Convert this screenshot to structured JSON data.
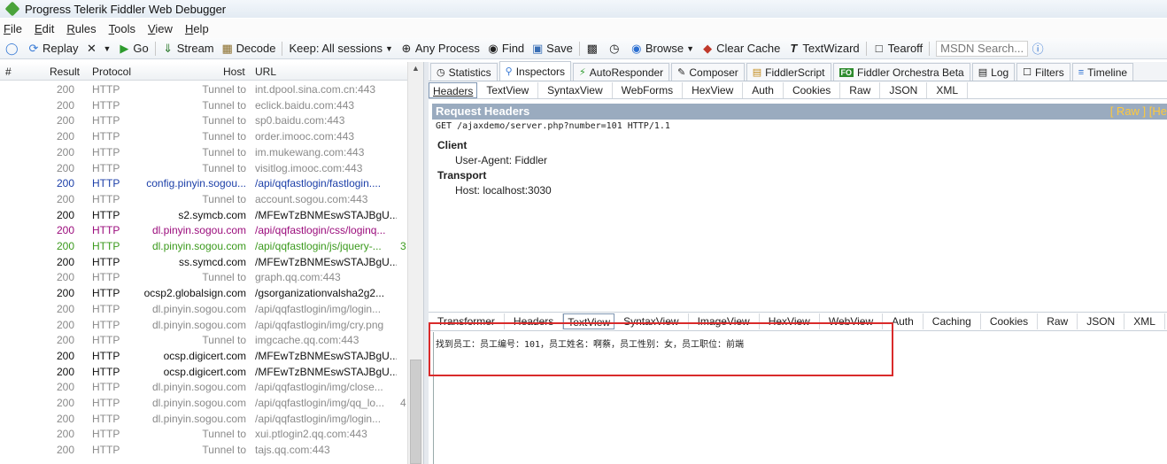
{
  "window": {
    "title": "Progress Telerik Fiddler Web Debugger"
  },
  "menu": [
    "File",
    "Edit",
    "Rules",
    "Tools",
    "View",
    "Help"
  ],
  "toolbar": {
    "replay": "Replay",
    "go": "Go",
    "stream": "Stream",
    "decode": "Decode",
    "keep": "Keep: All sessions",
    "any_process": "Any Process",
    "find": "Find",
    "save": "Save",
    "browse": "Browse",
    "clear_cache": "Clear Cache",
    "textwizard": "TextWizard",
    "tearoff": "Tearoff",
    "msdn_placeholder": "MSDN Search..."
  },
  "session_list": {
    "columns": [
      "#",
      "Result",
      "Protocol",
      "Host",
      "URL"
    ],
    "rows": [
      {
        "id": "42",
        "result": "200",
        "protocol": "HTTP",
        "host": "Tunnel to",
        "url": "int.dpool.sina.com.cn:443",
        "style": "tunnel"
      },
      {
        "id": "43",
        "result": "200",
        "protocol": "HTTP",
        "host": "Tunnel to",
        "url": "eclick.baidu.com:443",
        "style": "tunnel"
      },
      {
        "id": "44",
        "result": "200",
        "protocol": "HTTP",
        "host": "Tunnel to",
        "url": "sp0.baidu.com:443",
        "style": "tunnel"
      },
      {
        "id": "45",
        "result": "200",
        "protocol": "HTTP",
        "host": "Tunnel to",
        "url": "order.imooc.com:443",
        "style": "tunnel"
      },
      {
        "id": "46",
        "result": "200",
        "protocol": "HTTP",
        "host": "Tunnel to",
        "url": "im.mukewang.com:443",
        "style": "tunnel"
      },
      {
        "id": "47",
        "result": "200",
        "protocol": "HTTP",
        "host": "Tunnel to",
        "url": "visitlog.imooc.com:443",
        "style": "tunnel"
      },
      {
        "id": "48",
        "result": "200",
        "protocol": "HTTP",
        "host": "config.pinyin.sogou...",
        "url": "/api/qqfastlogin/fastlogin....",
        "style": "blue"
      },
      {
        "id": "49",
        "result": "200",
        "protocol": "HTTP",
        "host": "Tunnel to",
        "url": "account.sogou.com:443",
        "style": "tunnel"
      },
      {
        "id": "50",
        "result": "200",
        "protocol": "HTTP",
        "host": "s2.symcb.com",
        "url": "/MFEwTzBNMEswSTAJBgU...",
        "style": "dark"
      },
      {
        "id": "51",
        "result": "200",
        "protocol": "HTTP",
        "host": "dl.pinyin.sogou.com",
        "url": "/api/qqfastlogin/css/loginq...",
        "style": "purple"
      },
      {
        "id": "52",
        "result": "200",
        "protocol": "HTTP",
        "host": "dl.pinyin.sogou.com",
        "url": "/api/qqfastlogin/js/jquery-...",
        "style": "green",
        "extra": "3"
      },
      {
        "id": "53",
        "result": "200",
        "protocol": "HTTP",
        "host": "ss.symcd.com",
        "url": "/MFEwTzBNMEswSTAJBgU...",
        "style": "dark"
      },
      {
        "id": "54",
        "result": "200",
        "protocol": "HTTP",
        "host": "Tunnel to",
        "url": "graph.qq.com:443",
        "style": "tunnel"
      },
      {
        "id": "55",
        "result": "200",
        "protocol": "HTTP",
        "host": "ocsp2.globalsign.com",
        "url": "/gsorganizationvalsha2g2...",
        "style": "dark"
      },
      {
        "id": "56",
        "result": "200",
        "protocol": "HTTP",
        "host": "dl.pinyin.sogou.com",
        "url": "/api/qqfastlogin/img/login...",
        "style": "tunnel"
      },
      {
        "id": "57",
        "result": "200",
        "protocol": "HTTP",
        "host": "dl.pinyin.sogou.com",
        "url": "/api/qqfastlogin/img/cry.png",
        "style": "tunnel"
      },
      {
        "id": "58",
        "result": "200",
        "protocol": "HTTP",
        "host": "Tunnel to",
        "url": "imgcache.qq.com:443",
        "style": "tunnel"
      },
      {
        "id": "59",
        "result": "200",
        "protocol": "HTTP",
        "host": "ocsp.digicert.com",
        "url": "/MFEwTzBNMEswSTAJBgU...",
        "style": "dark"
      },
      {
        "id": "60",
        "result": "200",
        "protocol": "HTTP",
        "host": "ocsp.digicert.com",
        "url": "/MFEwTzBNMEswSTAJBgU...",
        "style": "dark"
      },
      {
        "id": "61",
        "result": "200",
        "protocol": "HTTP",
        "host": "dl.pinyin.sogou.com",
        "url": "/api/qqfastlogin/img/close...",
        "style": "tunnel"
      },
      {
        "id": "62",
        "result": "200",
        "protocol": "HTTP",
        "host": "dl.pinyin.sogou.com",
        "url": "/api/qqfastlogin/img/qq_lo...",
        "style": "tunnel",
        "extra": "4"
      },
      {
        "id": "63",
        "result": "200",
        "protocol": "HTTP",
        "host": "dl.pinyin.sogou.com",
        "url": "/api/qqfastlogin/img/login...",
        "style": "tunnel"
      },
      {
        "id": "64",
        "result": "200",
        "protocol": "HTTP",
        "host": "Tunnel to",
        "url": "xui.ptlogin2.qq.com:443",
        "style": "tunnel"
      },
      {
        "id": "65",
        "result": "200",
        "protocol": "HTTP",
        "host": "Tunnel to",
        "url": "tajs.qq.com:443",
        "style": "tunnel"
      }
    ]
  },
  "inspector": {
    "main_tabs": [
      "Statistics",
      "Inspectors",
      "AutoResponder",
      "Composer",
      "FiddlerScript",
      "Fiddler Orchestra Beta",
      "Log",
      "Filters",
      "Timeline"
    ],
    "fo_badge": "FO",
    "request_tabs": [
      "Headers",
      "TextView",
      "SyntaxView",
      "WebForms",
      "HexView",
      "Auth",
      "Cookies",
      "Raw",
      "JSON",
      "XML"
    ],
    "request_header_title": "Request Headers",
    "request_header_raw": "[ Raw ]  [He",
    "request_line": "GET /ajaxdemo/server.php?number=101 HTTP/1.1",
    "client_label": "Client",
    "client_value": "User-Agent: Fiddler",
    "transport_label": "Transport",
    "transport_value": "Host: localhost:3030",
    "response_tabs": [
      "Transformer",
      "Headers",
      "TextView",
      "SyntaxView",
      "ImageView",
      "HexView",
      "WebView",
      "Auth",
      "Caching",
      "Cookies",
      "Raw",
      "JSON",
      "XML"
    ],
    "response_text": "找到员工：员工编号：101，员工姓名：啊蔡，员工性别：女，员工职位：前端"
  }
}
